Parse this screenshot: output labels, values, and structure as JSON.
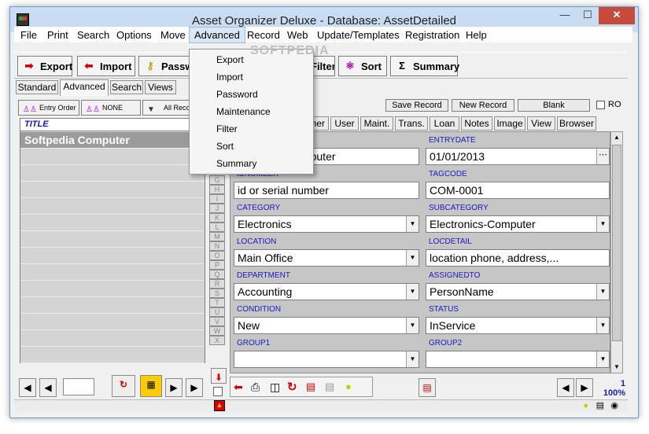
{
  "window": {
    "title": "Asset Organizer Deluxe - Database: AssetDetailed"
  },
  "menubar": {
    "items": [
      "File",
      "Print",
      "Search",
      "Options",
      "Move",
      "Advanced",
      "Record",
      "Web",
      "Update/Templates",
      "Registration",
      "Help"
    ],
    "active": "Advanced"
  },
  "toolbar": {
    "export": "Export",
    "import": "Import",
    "password": "Password",
    "filter": "Filter",
    "sort": "Sort",
    "summary": "Summary"
  },
  "advanced_menu": [
    "Export",
    "Import",
    "Password",
    "Maintenance",
    "Filter",
    "Sort",
    "Summary"
  ],
  "watermark": "SOFTPEDIA",
  "left_tabs": [
    "Standard",
    "Advanced",
    "Search",
    "Views"
  ],
  "left_tabs_selected": "Advanced",
  "filter_buttons": {
    "entry_order": "Entry Order",
    "none": "NONE",
    "all_records": "All Records"
  },
  "list": {
    "column": "TITLE",
    "rows": [
      "Softpedia Computer",
      "",
      "",
      "",
      "",
      "",
      "",
      "",
      "",
      "",
      "",
      "",
      "",
      ""
    ],
    "selected": "Softpedia Computer"
  },
  "alpha_index": [
    "G",
    "H",
    "I",
    "J",
    "K",
    "L",
    "M",
    "N",
    "O",
    "P",
    "Q",
    "R",
    "S",
    "T",
    "U",
    "V",
    "W",
    "X"
  ],
  "record_buttons": {
    "save": "Save Record",
    "new": "New Record",
    "blank": "Blank",
    "ro": "RO"
  },
  "right_tabs": [
    "Other",
    "User",
    "Maint.",
    "Trans.",
    "Loan",
    "Notes",
    "Image",
    "View",
    "Browser"
  ],
  "fields": {
    "title_value": "Softpedia Computer",
    "entrydate_label": "ENTRYDATE",
    "entrydate_value": "01/01/2013",
    "idnumber_label": "IDNUMBER",
    "idnumber_value": "id or serial number",
    "tagcode_label": "TAGCODE",
    "tagcode_value": "COM-0001",
    "category_label": "CATEGORY",
    "category_value": "Electronics",
    "subcategory_label": "SUBCATEGORY",
    "subcategory_value": "Electronics-Computer",
    "location_label": "LOCATION",
    "location_value": "Main Office",
    "locdetail_label": "LOCDETAIL",
    "locdetail_value": "location phone, address,...",
    "department_label": "DEPARTMENT",
    "department_value": "Accounting",
    "assignedto_label": "ASSIGNEDTO",
    "assignedto_value": "PersonName",
    "condition_label": "CONDITION",
    "condition_value": "New",
    "status_label": "STATUS",
    "status_value": "InService",
    "group1_label": "GROUP1",
    "group1_value": "",
    "group2_label": "GROUP2",
    "group2_value": ""
  },
  "record_info": {
    "index": "1",
    "zoom": "100%"
  },
  "colors": {
    "label_blue": "#1a1abf",
    "title_bar": "#c9dcf1",
    "close_red": "#c74b3a"
  }
}
